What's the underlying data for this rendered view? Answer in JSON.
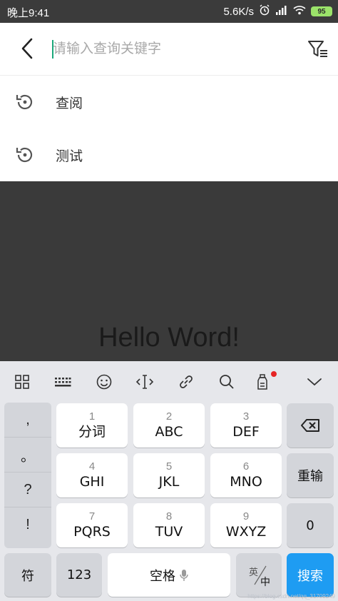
{
  "status_bar": {
    "time": "晚上9:41",
    "network_speed": "5.6K/s",
    "battery": "95",
    "icons": [
      "alarm-icon",
      "signal-icon",
      "wifi-icon",
      "battery-icon"
    ]
  },
  "search": {
    "placeholder": "请输入查询关键字",
    "value": "",
    "back_icon": "chevron-left-icon",
    "filter_icon": "filter-icon"
  },
  "history": [
    {
      "label": "查阅",
      "icon": "history-icon"
    },
    {
      "label": "测试",
      "icon": "history-icon"
    }
  ],
  "content": {
    "text": "Hello Word!"
  },
  "keyboard": {
    "toolbar": [
      "grid-menu-icon",
      "keyboard-icon",
      "emoji-icon",
      "cursor-move-icon",
      "link-icon",
      "search-icon",
      "clipboard-icon",
      "chevron-down-icon"
    ],
    "punctuation": [
      ",",
      "。",
      "?",
      "!"
    ],
    "keys": [
      {
        "num": "1",
        "label": "分词"
      },
      {
        "num": "2",
        "label": "ABC"
      },
      {
        "num": "3",
        "label": "DEF"
      },
      {
        "num": "4",
        "label": "GHI"
      },
      {
        "num": "5",
        "label": "JKL"
      },
      {
        "num": "6",
        "label": "MNO"
      },
      {
        "num": "7",
        "label": "PQRS"
      },
      {
        "num": "8",
        "label": "TUV"
      },
      {
        "num": "9",
        "label": "WXYZ"
      }
    ],
    "backspace_icon": "backspace-icon",
    "reenter": "重输",
    "zero": "0",
    "symbol": "符",
    "numbers": "123",
    "space": "空格",
    "lang_top": "英",
    "lang_bottom": "中",
    "search": "搜索",
    "accent": "#1e9cf2"
  },
  "watermark": "https://blog.csdn.net/qq_31709249"
}
